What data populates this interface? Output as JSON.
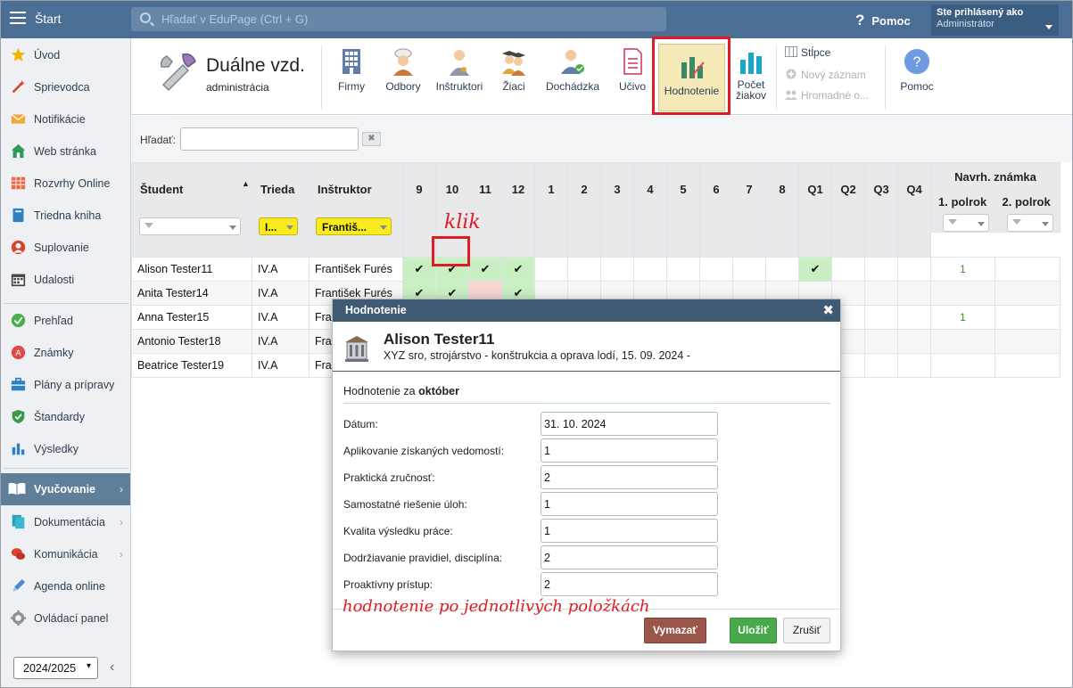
{
  "topbar": {
    "start_label": "Štart",
    "search_placeholder": "Hľadať v EduPage (Ctrl + G)",
    "help_label": "Pomoc",
    "user_line1": "Ste prihlásený ako",
    "user_line2": "Administrátor"
  },
  "sidebar": {
    "items": [
      {
        "label": "Úvod",
        "icon": "star-icon"
      },
      {
        "label": "Sprievodca",
        "icon": "magic-wand-icon"
      },
      {
        "label": "Notifikácie",
        "icon": "envelope-icon"
      },
      {
        "label": "Web stránka",
        "icon": "house-icon"
      },
      {
        "label": "Rozvrhy Online",
        "icon": "timetable-icon"
      },
      {
        "label": "Triedna kniha",
        "icon": "book-icon"
      },
      {
        "label": "Suplovanie",
        "icon": "substitute-icon"
      },
      {
        "label": "Udalosti",
        "icon": "calendar-icon"
      },
      {
        "label": "Prehľad",
        "icon": "check-circle-icon"
      },
      {
        "label": "Známky",
        "icon": "grades-icon"
      },
      {
        "label": "Plány a prípravy",
        "icon": "briefcase-icon"
      },
      {
        "label": "Štandardy",
        "icon": "shield-check-icon"
      },
      {
        "label": "Výsledky",
        "icon": "bar-chart-icon"
      },
      {
        "label": "Vyučovanie",
        "icon": "open-book-icon"
      },
      {
        "label": "Dokumentácia",
        "icon": "documents-icon"
      },
      {
        "label": "Komunikácia",
        "icon": "chat-icon"
      },
      {
        "label": "Agenda online",
        "icon": "pen-icon"
      },
      {
        "label": "Ovládací panel",
        "icon": "gear-icon"
      }
    ],
    "year": "2024/2025"
  },
  "ribbon": {
    "module_title": "Duálne vzd.",
    "module_sub": "administrácia",
    "buttons": {
      "firmy": "Firmy",
      "odbory": "Odbory",
      "instruktori": "Inštruktori",
      "ziaci": "Žiaci",
      "dochadzka": "Dochádzka",
      "ucivo": "Učivo",
      "hodnotenie": "Hodnotenie",
      "pocet1": "Počet",
      "pocet2": "žiakov",
      "stlpce": "Stĺpce",
      "novy": "Nový záznam",
      "hromadne": "Hromadné o...",
      "pomoc": "Pomoc"
    }
  },
  "filter": {
    "label": "Hľadať:"
  },
  "table": {
    "headers": {
      "student": "Študent",
      "trieda": "Trieda",
      "instruktor": "Inštruktor",
      "months": [
        "9",
        "10",
        "11",
        "12",
        "1",
        "2",
        "3",
        "4",
        "5",
        "6",
        "7",
        "8",
        "Q1",
        "Q2",
        "Q3",
        "Q4"
      ],
      "navrh": "Navrh. známka",
      "p1": "1. polrok",
      "p2": "2. polrok"
    },
    "filter_trieda": "I...",
    "filter_instruktor": "Františ...",
    "rows": [
      {
        "student": "Alison Tester11",
        "trieda": "IV.A",
        "instruktor": "František Furés",
        "p1": "1"
      },
      {
        "student": "Anita Tester14",
        "trieda": "IV.A",
        "instruktor": "František Furés",
        "p1": ""
      },
      {
        "student": "Anna Tester15",
        "trieda": "IV.A",
        "instruktor": "František Furés",
        "p1": "1"
      },
      {
        "student": "Antonio Tester18",
        "trieda": "IV.A",
        "instruktor": "Františ",
        "p1": ""
      },
      {
        "student": "Beatrice Tester19",
        "trieda": "IV.A",
        "instruktor": "Františ",
        "p1": ""
      }
    ]
  },
  "annotations": {
    "klik": "klik",
    "hodnotenie": "hodnotenie po jednotlivých položkách"
  },
  "modal": {
    "title": "Hodnotenie",
    "name": "Alison Tester11",
    "desc": "XYZ sro, strojárstvo - konštrukcia a oprava lodí, 15. 09. 2024 -",
    "section_prefix": "Hodnotenie za",
    "section_month": "október",
    "fields": [
      {
        "label": "Dátum:",
        "value": "31. 10. 2024"
      },
      {
        "label": "Aplikovanie získaných vedomostí:",
        "value": "1"
      },
      {
        "label": "Praktická zručnosť:",
        "value": "2"
      },
      {
        "label": "Samostatné riešenie úloh:",
        "value": "1"
      },
      {
        "label": "Kvalita výsledku práce:",
        "value": "1"
      },
      {
        "label": "Dodržiavanie pravidiel, disciplína:",
        "value": "2"
      },
      {
        "label": "Proaktívny prístup:",
        "value": "2"
      }
    ],
    "btn_delete": "Vymazať",
    "btn_save": "Uložiť",
    "btn_cancel": "Zrušiť"
  }
}
